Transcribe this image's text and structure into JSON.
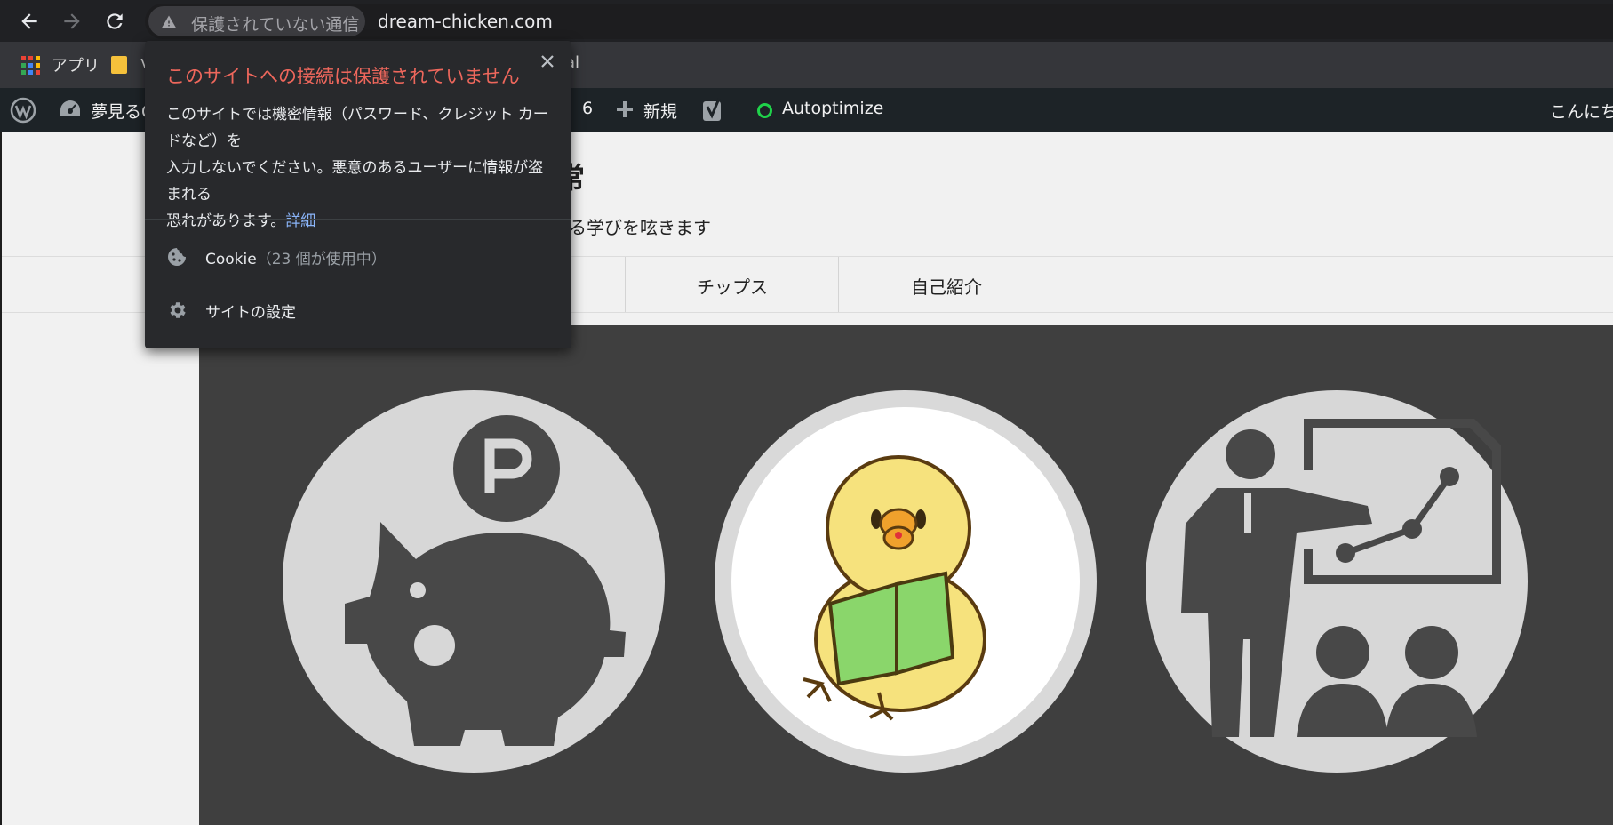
{
  "browser": {
    "security_chip_text": "保護されていない通信",
    "url": "dream-chicken.com"
  },
  "bookmarks": {
    "apps_label": "アプリ",
    "folder_label_fragment": "v",
    "trailing_fragment": "al"
  },
  "adminbar": {
    "site_name_fragment": "夢見るC",
    "updates_count": "6",
    "new_label": "新規",
    "autoptimize_label": "Autoptimize",
    "greeting_fragment": "こんにち"
  },
  "page": {
    "title_fragment": "常",
    "tagline_fragment": "る学びを呟きます",
    "nav": [
      "チップス",
      "自己紹介"
    ]
  },
  "popup": {
    "title": "このサイトへの接続は保護されていません",
    "body_line1": "このサイトでは機密情報（パスワード、クレジット カードなど）を",
    "body_line2": "入力しないでください。悪意のあるユーザーに情報が盗まれる",
    "body_line3": "恐れがあります。",
    "details_link": "詳細",
    "cookie_label": "Cookie",
    "cookie_count": "（23 個が使用中）",
    "site_settings_label": "サイトの設定"
  },
  "colors": {
    "warning_title": "#ee675c",
    "link": "#8ab4f8",
    "autoptimize_status": "#1fd24a"
  }
}
